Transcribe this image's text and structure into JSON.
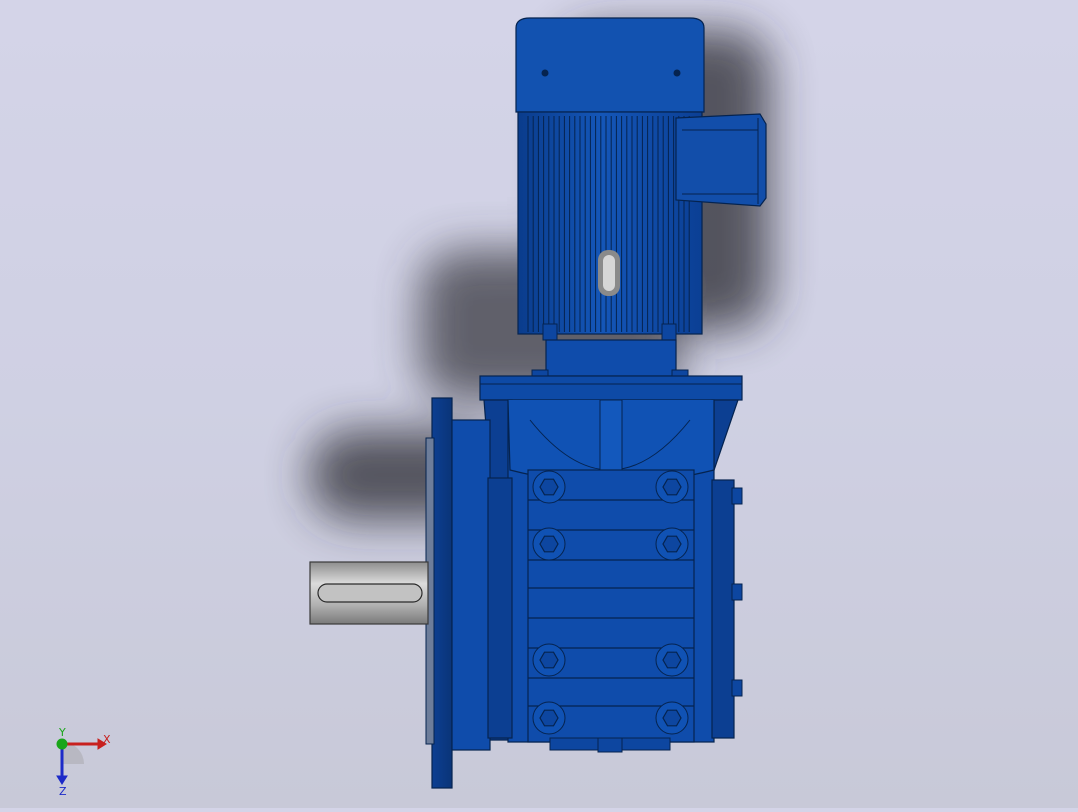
{
  "viewport": {
    "background_top": "#d4d4e8",
    "background_bottom": "#c8c9d8",
    "model_color": "#0e4aa6",
    "model_color_dark": "#08306e",
    "shaft_color": "#b4b4b4"
  },
  "triad": {
    "x_label": "X",
    "y_label": "Y",
    "z_label": "Z",
    "x_color": "#c8201e",
    "y_color": "#1aa51a",
    "z_color": "#1c2ac8"
  }
}
